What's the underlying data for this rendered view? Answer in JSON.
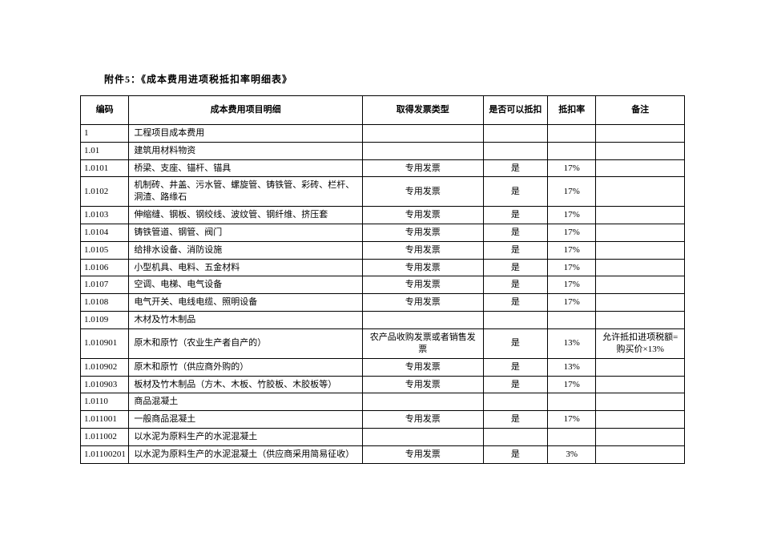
{
  "title": "附件5：《成本费用进项税抵扣率明细表》",
  "headers": {
    "code": "编码",
    "item": "成本费用项目明细",
    "invoice": "取得发票类型",
    "deduct": "是否可以抵扣",
    "rate": "抵扣率",
    "remark": "备注"
  },
  "rows": [
    {
      "code": "1",
      "item": "工程项目成本费用",
      "invoice": "",
      "deduct": "",
      "rate": "",
      "remark": ""
    },
    {
      "code": "1.01",
      "item": "建筑用材料物资",
      "invoice": "",
      "deduct": "",
      "rate": "",
      "remark": ""
    },
    {
      "code": "1.0101",
      "item": "桥梁、支座、锚杆、锚具",
      "invoice": "专用发票",
      "deduct": "是",
      "rate": "17%",
      "remark": ""
    },
    {
      "code": "1.0102",
      "item": "机制砖、井盖、污水管、螺旋管、铸铁管、彩砖、栏杆、洞渣、路缘石",
      "invoice": "专用发票",
      "deduct": "是",
      "rate": "17%",
      "remark": ""
    },
    {
      "code": "1.0103",
      "item": "伸缩缝、钢板、钢绞线、波纹管、钢纤维、挤压套",
      "invoice": "专用发票",
      "deduct": "是",
      "rate": "17%",
      "remark": ""
    },
    {
      "code": "1.0104",
      "item": "铸铁管道、钢管、阀门",
      "invoice": "专用发票",
      "deduct": "是",
      "rate": "17%",
      "remark": ""
    },
    {
      "code": "1.0105",
      "item": "给排水设备、消防设施",
      "invoice": "专用发票",
      "deduct": "是",
      "rate": "17%",
      "remark": ""
    },
    {
      "code": "1.0106",
      "item": "小型机具、电料、五金材料",
      "invoice": "专用发票",
      "deduct": "是",
      "rate": "17%",
      "remark": ""
    },
    {
      "code": "1.0107",
      "item": "空调、电梯、电气设备",
      "invoice": "专用发票",
      "deduct": "是",
      "rate": "17%",
      "remark": ""
    },
    {
      "code": "1.0108",
      "item": "电气开关、电线电缆、照明设备",
      "invoice": "专用发票",
      "deduct": "是",
      "rate": "17%",
      "remark": ""
    },
    {
      "code": "1.0109",
      "item": "木材及竹木制品",
      "invoice": "",
      "deduct": "",
      "rate": "",
      "remark": ""
    },
    {
      "code": "1.010901",
      "item": "原木和原竹（农业生产者自产的）",
      "invoice": "农产品收购发票或者销售发票",
      "deduct": "是",
      "rate": "13%",
      "remark": "允许抵扣进项税额=购买价×13%"
    },
    {
      "code": "1.010902",
      "item": "原木和原竹（供应商外购的）",
      "invoice": "专用发票",
      "deduct": "是",
      "rate": "13%",
      "remark": ""
    },
    {
      "code": "1.010903",
      "item": "板材及竹木制品（方木、木板、竹胶板、木胶板等）",
      "invoice": "专用发票",
      "deduct": "是",
      "rate": "17%",
      "remark": ""
    },
    {
      "code": "1.0110",
      "item": "商品混凝土",
      "invoice": "",
      "deduct": "",
      "rate": "",
      "remark": ""
    },
    {
      "code": "1.011001",
      "item": "一般商品混凝土",
      "invoice": "专用发票",
      "deduct": "是",
      "rate": "17%",
      "remark": ""
    },
    {
      "code": "1.011002",
      "item": "以水泥为原料生产的水泥混凝土",
      "invoice": "",
      "deduct": "",
      "rate": "",
      "remark": ""
    },
    {
      "code": "1.01100201",
      "item": "以水泥为原料生产的水泥混凝土（供应商采用简易征收）",
      "invoice": "专用发票",
      "deduct": "是",
      "rate": "3%",
      "remark": ""
    }
  ]
}
